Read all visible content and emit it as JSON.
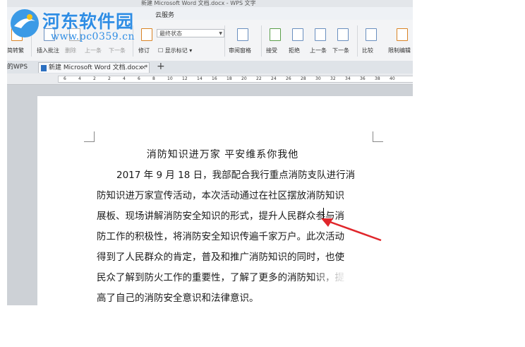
{
  "watermark": {
    "name": "河东软件园",
    "url": "www.pc0359.cn"
  },
  "titlebar": {
    "text": "新建 Microsoft Word 文档.docx - WPS 文字"
  },
  "menu": {
    "cloud": "云服务"
  },
  "ribbon": {
    "left_stub": "简转繁",
    "insert_comment": "插入批注",
    "delete": "删除",
    "prev1": "上一条",
    "next1": "下一条",
    "revise": "修订",
    "status_combo": "最终状态",
    "show_markup": "显示标记",
    "review_pane": "审阅窗格",
    "accept": "接受",
    "reject": "拒绝",
    "prev2": "上一条",
    "next2": "下一条",
    "compare": "比较",
    "restrict": "限制编辑"
  },
  "tabs": {
    "wps": "的WPS",
    "doc": "新建 Microsoft Word 文档.docx *",
    "close": "×",
    "new": "+"
  },
  "ruler": {
    "ticks": [
      "6",
      "4",
      "2",
      "2",
      "4",
      "6",
      "8",
      "10",
      "12",
      "14",
      "16",
      "18",
      "20",
      "22",
      "24",
      "26",
      "28",
      "30",
      "32",
      "34",
      "36",
      "38",
      "40"
    ]
  },
  "document": {
    "title": "消防知识进万家  平安维系你我他",
    "lines": [
      "2017 年 9 月 18 日，我部配合我行重点消防支队进行消",
      "防知识进万家宣传活动，本次活动通过在社区摆放消防知识",
      "展板、现场讲解消防安全知识的形式，提升人民群众参与消",
      "防工作的积极性，将消防安全知识传遍千家万户。此次活动",
      "得到了人民群众的肯定，普及和推广消防知识的同时，也使",
      "民众了解到防火工作的重要性，了解了更多的消防知识，提",
      "高了自己的消防安全意识和法律意识。"
    ]
  },
  "colors": {
    "accent": "#2f8de4",
    "arrow": "#e0262b",
    "doc_icon": "#2b6fc0"
  }
}
